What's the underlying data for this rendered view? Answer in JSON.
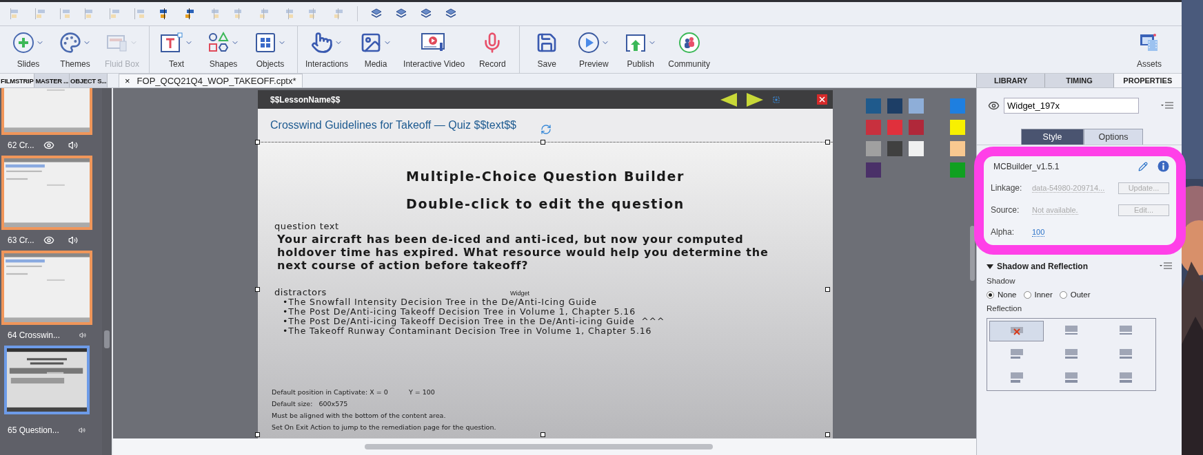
{
  "toolbar": {
    "groups": [
      [
        {
          "kind": "slides",
          "label": "Slides",
          "menu": true,
          "disabled": false
        },
        {
          "kind": "themes",
          "label": "Themes",
          "menu": true,
          "disabled": false
        },
        {
          "kind": "fluid",
          "label": "Fluid Box",
          "menu": true,
          "disabled": true
        }
      ],
      [
        {
          "kind": "text",
          "label": "Text",
          "menu": true,
          "disabled": false
        },
        {
          "kind": "shapes",
          "label": "Shapes",
          "menu": true,
          "disabled": false
        },
        {
          "kind": "objects",
          "label": "Objects",
          "menu": true,
          "disabled": false
        }
      ],
      [
        {
          "kind": "interactions",
          "label": "Interactions",
          "menu": true,
          "disabled": false
        },
        {
          "kind": "media",
          "label": "Media",
          "menu": true,
          "disabled": false
        },
        {
          "kind": "video",
          "label": "Interactive Video",
          "menu": false,
          "disabled": false
        },
        {
          "kind": "record",
          "label": "Record",
          "menu": false,
          "disabled": false
        }
      ],
      [
        {
          "kind": "save",
          "label": "Save",
          "menu": false,
          "disabled": false
        },
        {
          "kind": "preview",
          "label": "Preview",
          "menu": true,
          "disabled": false
        },
        {
          "kind": "publish",
          "label": "Publish",
          "menu": true,
          "disabled": false
        },
        {
          "kind": "community",
          "label": "Community",
          "menu": false,
          "disabled": false
        }
      ]
    ],
    "assets": {
      "label": "Assets"
    }
  },
  "panel_tabs": [
    {
      "label": "FILMSTRIP",
      "selected": true
    },
    {
      "label": "MASTER ...",
      "selected": false
    },
    {
      "label": "OBJECT S...",
      "selected": false
    }
  ],
  "document_tab": {
    "close": "×",
    "label": "FOP_QCQ21Q4_WOP_TAKEOFF.cptx*"
  },
  "right_tabs": [
    {
      "label": "LIBRARY",
      "selected": false
    },
    {
      "label": "TIMING",
      "selected": false
    },
    {
      "label": "PROPERTIES",
      "selected": true
    }
  ],
  "filmstrip": [
    {
      "label": "62 Cr...",
      "kind": "plain",
      "eye": true,
      "audio": true,
      "selected": false
    },
    {
      "label": "63 Cr...",
      "kind": "content",
      "eye": true,
      "audio": true,
      "selected": false
    },
    {
      "label": "64 Crosswin...",
      "kind": "content",
      "eye": false,
      "audio": true,
      "selected": false
    },
    {
      "label": "65 Question...",
      "kind": "question",
      "eye": false,
      "audio": true,
      "selected": true
    }
  ],
  "slide": {
    "header": "$$LessonName$$",
    "subtitle": "Crosswind Guidelines for Takeoff — Quiz $$text$$",
    "widget": {
      "headings": [
        "Multiple-Choice Question Builder",
        "Double-click to edit the question"
      ],
      "question_label": "question text",
      "question": "Your aircraft has been de-iced and anti-iced, but now your computed holdover time has expired. What resource would help you determine the next course of action before takeoff?",
      "distractors_label": "distractors",
      "widget_label": "Widget",
      "distractors": [
        "•The Snowfall Intensity Decision Tree in the De/Anti-Icing Guide",
        "•The Post De/Anti-icing Takeoff Decision Tree in Volume 1, Chapter 5.16",
        "•The Post De/Anti-icing Takeoff Decision Tree in the De/Anti-icing Guide  ^^^",
        "•The Takeoff Runway Contaminant Decision Tree in Volume 1, Chapter 5.16"
      ],
      "notes": [
        "Default position in Captivate: X = 0          Y = 100",
        "Default size:   600x575",
        "Must be aligned with the bottom of the content area.",
        "Set On Exit Action to jump to the remediation page for the question."
      ]
    }
  },
  "swatch_groups": [
    [
      {
        "color": "#1f5a8c"
      },
      {
        "color": "#1d3e66"
      },
      {
        "color": "#8eaed8"
      },
      {
        "color": "#c8303e"
      },
      {
        "color": "#e0303c"
      },
      {
        "color": "#b0283a"
      },
      {
        "color": "#a0a0a0"
      },
      {
        "color": "#404040"
      },
      {
        "color": "#f0f0f0"
      },
      {
        "color": "#4a3068"
      }
    ],
    [
      {
        "color": "#1e7fe0"
      },
      {
        "color": "#f8f000"
      },
      {
        "color": "#f8c890"
      },
      {
        "color": "#10a020"
      }
    ]
  ],
  "properties": {
    "name_value": "Widget_197x",
    "style_tabs": [
      {
        "label": "Style",
        "selected": true
      },
      {
        "label": "Options",
        "selected": false
      }
    ],
    "widget": {
      "title": "MCBuilder_v1.5.1",
      "rows": [
        {
          "kind": "button",
          "label": "Linkage:",
          "value": "data-54980-209714...",
          "button": "Update..."
        },
        {
          "kind": "button",
          "label": "Source:",
          "value": "Not available.",
          "button": "Edit..."
        },
        {
          "kind": "number",
          "label": "Alpha:",
          "value": "100"
        }
      ]
    },
    "shadow_section": {
      "title": "Shadow and Reflection",
      "expanded": true,
      "shadow_label": "Shadow",
      "shadow_options": [
        {
          "label": "None",
          "selected": true
        },
        {
          "label": "Inner",
          "selected": false
        },
        {
          "label": "Outer",
          "selected": false
        }
      ],
      "reflection_label": "Reflection",
      "reflections": [
        {
          "kind": "none",
          "selected": true
        },
        {
          "kind": "reflect",
          "selected": false
        },
        {
          "kind": "reflect",
          "selected": false
        },
        {
          "kind": "reflect",
          "selected": false
        },
        {
          "kind": "reflect",
          "selected": false
        },
        {
          "kind": "reflect",
          "selected": false
        },
        {
          "kind": "reflect",
          "selected": false
        },
        {
          "kind": "reflect",
          "selected": false
        },
        {
          "kind": "reflect",
          "selected": false
        }
      ]
    }
  }
}
